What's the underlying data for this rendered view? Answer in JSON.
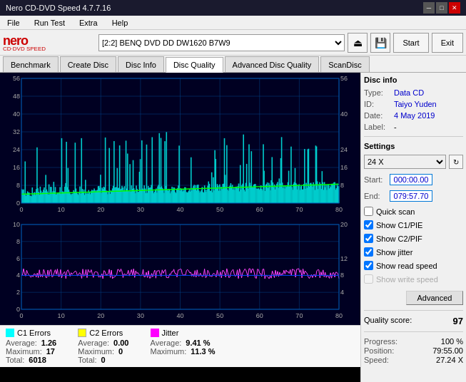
{
  "titleBar": {
    "title": "Nero CD-DVD Speed 4.7.7.16",
    "controls": [
      "minimize",
      "maximize",
      "close"
    ]
  },
  "menuBar": {
    "items": [
      "File",
      "Run Test",
      "Extra",
      "Help"
    ]
  },
  "toolbar": {
    "drive": "[2:2]  BENQ DVD DD DW1620 B7W9",
    "startLabel": "Start",
    "exitLabel": "Exit"
  },
  "tabs": [
    {
      "label": "Benchmark",
      "active": false
    },
    {
      "label": "Create Disc",
      "active": false
    },
    {
      "label": "Disc Info",
      "active": false
    },
    {
      "label": "Disc Quality",
      "active": true
    },
    {
      "label": "Advanced Disc Quality",
      "active": false
    },
    {
      "label": "ScanDisc",
      "active": false
    }
  ],
  "chart1": {
    "yMax": 56,
    "yAxisLabels": [
      56,
      40,
      24,
      16,
      8
    ],
    "xAxisLabels": [
      0,
      10,
      20,
      30,
      40,
      50,
      60,
      70,
      80
    ],
    "yMax2": 20,
    "yAxisLabels2": [
      20,
      12,
      8,
      4
    ]
  },
  "legend": {
    "c1": {
      "label": "C1 Errors",
      "color": "#00ffff",
      "average": "1.26",
      "maximum": "17",
      "total": "6018"
    },
    "c2": {
      "label": "C2 Errors",
      "color": "#ffff00",
      "average": "0.00",
      "maximum": "0",
      "total": "0"
    },
    "jitter": {
      "label": "Jitter",
      "color": "#ff00ff",
      "average": "9.41 %",
      "maximum": "11.3 %"
    }
  },
  "discInfo": {
    "sectionTitle": "Disc info",
    "typeLabel": "Type:",
    "typeValue": "Data CD",
    "idLabel": "ID:",
    "idValue": "Taiyo Yuden",
    "dateLabel": "Date:",
    "dateValue": "4 May 2019",
    "labelLabel": "Label:",
    "labelValue": "-"
  },
  "settings": {
    "sectionTitle": "Settings",
    "speedValue": "24 X",
    "startLabel": "Start:",
    "startValue": "000:00.00",
    "endLabel": "End:",
    "endValue": "079:57.70",
    "quickScan": "Quick scan",
    "showC1": "Show C1/PIE",
    "showC2": "Show C2/PIF",
    "showJitter": "Show jitter",
    "showReadSpeed": "Show read speed",
    "showWriteSpeed": "Show write speed",
    "advancedLabel": "Advanced"
  },
  "quality": {
    "scoreLabel": "Quality score:",
    "scoreValue": "97"
  },
  "progress": {
    "progressLabel": "Progress:",
    "progressValue": "100 %",
    "positionLabel": "Position:",
    "positionValue": "79:55.00",
    "speedLabel": "Speed:",
    "speedValue": "27.24 X"
  }
}
